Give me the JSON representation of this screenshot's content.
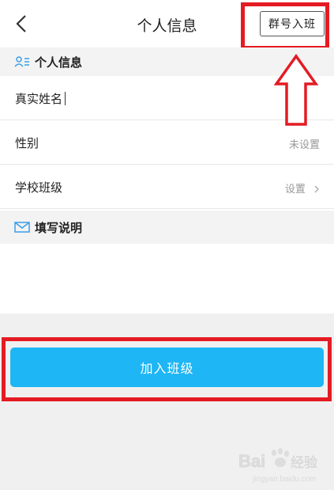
{
  "header": {
    "title": "个人信息",
    "join_by_group_label": "群号入班"
  },
  "personal_section": {
    "title": "个人信息"
  },
  "fields": {
    "real_name": {
      "label": "真实姓名",
      "value": ""
    },
    "gender": {
      "label": "性别",
      "value": "未设置"
    },
    "school_class": {
      "label": "学校班级",
      "value": "设置"
    }
  },
  "notes_section": {
    "title": "填写说明"
  },
  "join_button_label": "加入班级",
  "watermark": {
    "brand_a": "Bai",
    "brand_b": "经验",
    "url": "jingyan.baidu.com"
  },
  "colors": {
    "accent": "#1eb6f5",
    "highlight_red": "#e41b23",
    "icon_blue": "#3a9ee8"
  },
  "icons": [
    "back-arrow-icon",
    "contact-card-icon",
    "envelope-icon",
    "chevron-right-icon",
    "red-up-arrow-annotation"
  ]
}
